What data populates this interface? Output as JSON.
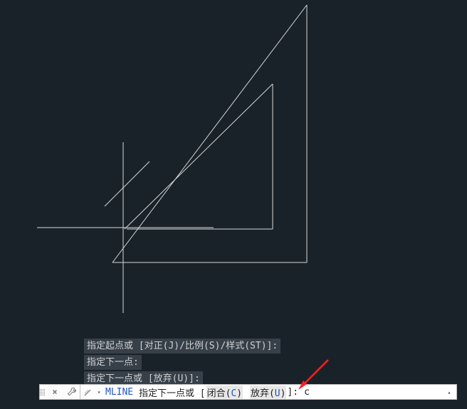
{
  "history": {
    "line1_prefix": "指定起点或 [",
    "line1_opts": "对正(J)/比例(S)/样式(ST)",
    "line1_suffix": "]:",
    "line2": "指定下一点:",
    "line3_prefix": "指定下一点或 [",
    "line3_opts": "放弃(U)",
    "line3_suffix": "]:"
  },
  "command": {
    "name": "MLINE",
    "prompt_prefix": "指定下一点或 [",
    "opt1_label": "闭合(",
    "opt1_key": "C",
    "opt1_close": ")",
    "opt2_label": "放弃(",
    "opt2_key": "U",
    "opt2_close": ")",
    "prompt_suffix": "]:",
    "typed": "c"
  },
  "icons": {
    "close": "×",
    "dropdown": "▾",
    "expand": "▴"
  }
}
